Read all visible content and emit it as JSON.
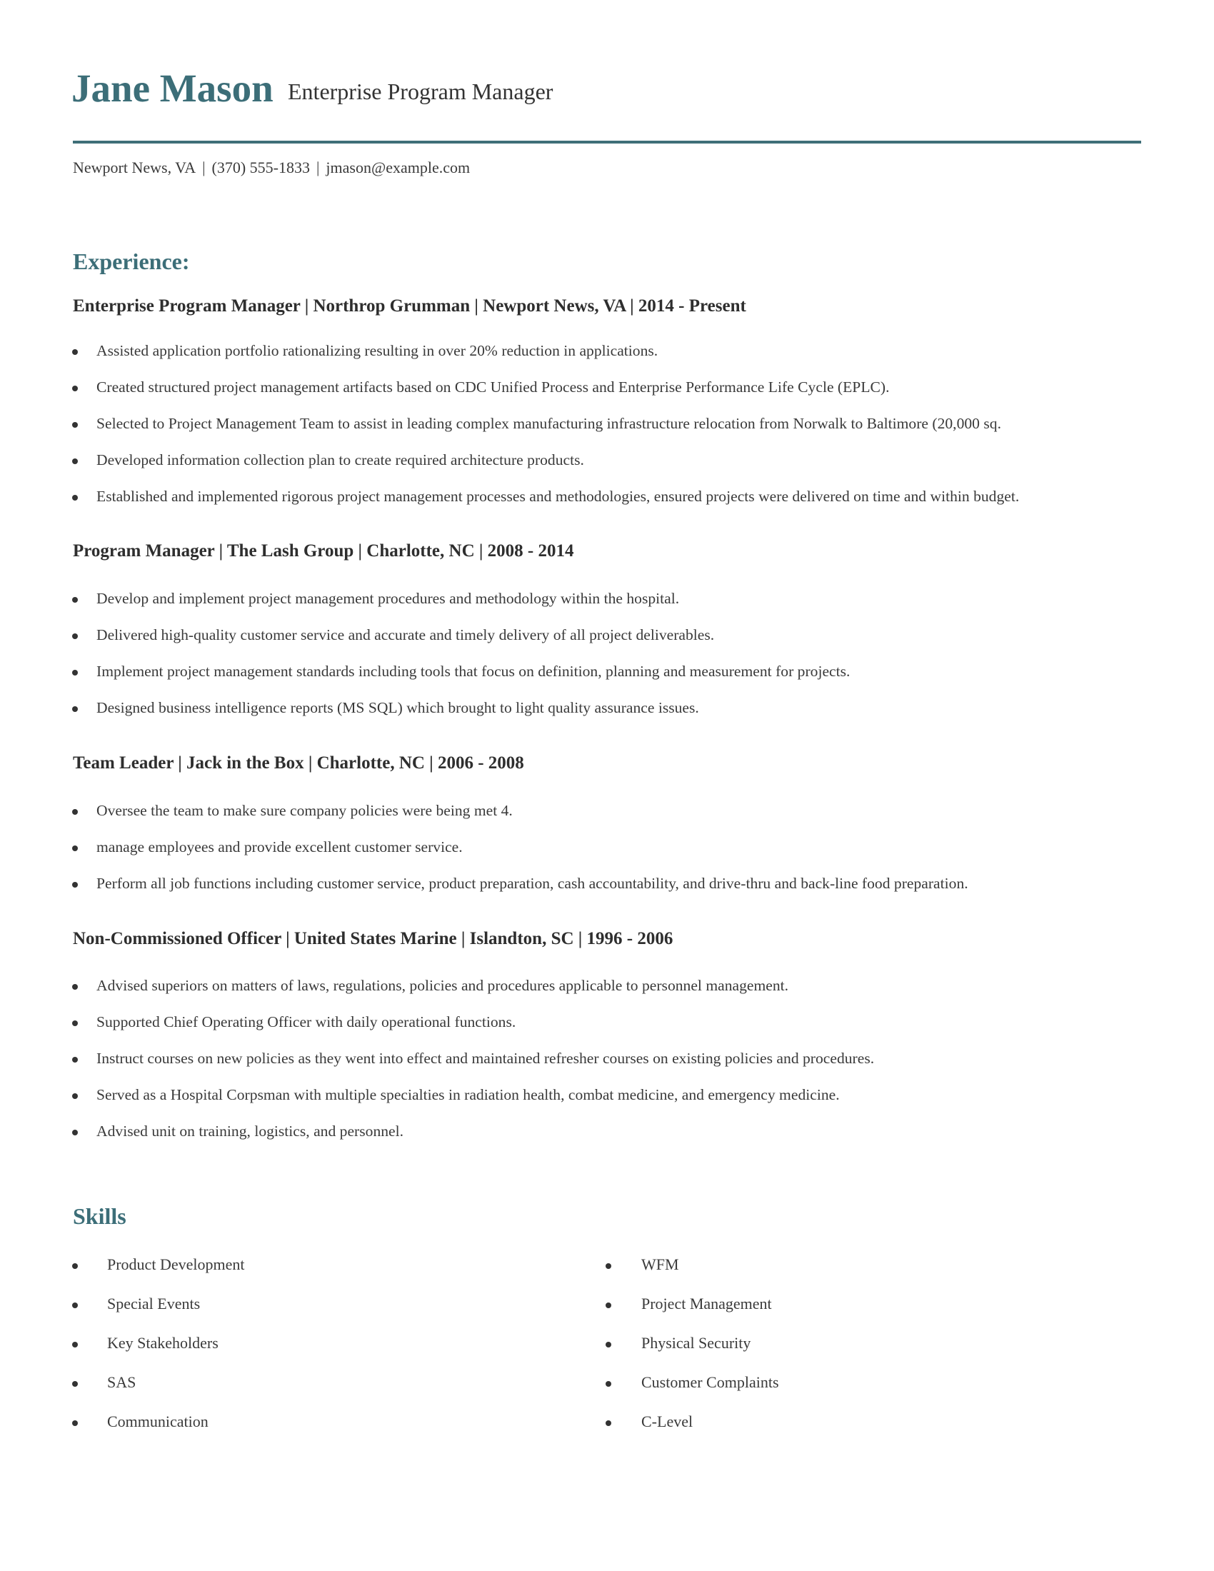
{
  "header": {
    "name": "Jane Mason",
    "title": "Enterprise Program Manager",
    "contact": {
      "location": "Newport News, VA",
      "phone": "(370) 555-1833",
      "email": "jmason@example.com",
      "separator": "|"
    }
  },
  "colors": {
    "accent": "#3c6e78",
    "text": "#333333"
  },
  "experience": {
    "heading": "Experience:",
    "jobs": [
      {
        "title": "Enterprise Program Manager | Northrop Grumman | Newport News, VA |  2014 - Present",
        "bullets": [
          "Assisted application portfolio rationalizing resulting in over 20% reduction in applications.",
          "Created structured project management artifacts based on CDC Unified Process and Enterprise Performance Life Cycle (EPLC).",
          "Selected to Project Management Team to assist in leading complex manufacturing infrastructure relocation from Norwalk to Baltimore (20,000 sq.",
          "Developed information collection plan to create required architecture products.",
          "Established and implemented rigorous project management processes and methodologies, ensured projects were delivered on time and within budget."
        ]
      },
      {
        "title": "Program Manager | The Lash Group | Charlotte, NC |  2008 - 2014",
        "bullets": [
          "Develop and implement project management procedures and methodology within the hospital.",
          "Delivered high-quality customer service and accurate and timely delivery of all project deliverables.",
          "Implement project management standards including tools that focus on definition, planning and measurement for projects.",
          "Designed business intelligence reports (MS SQL) which brought to light quality assurance issues."
        ]
      },
      {
        "title": "Team Leader | Jack in the Box | Charlotte, NC |  2006 - 2008",
        "bullets": [
          "Oversee the team to make sure company policies were being met 4.",
          "manage employees and provide excellent customer service.",
          "Perform all job functions including customer service, product preparation, cash accountability, and drive-thru and back-line food preparation."
        ]
      },
      {
        "title": "Non-Commissioned Officer | United States Marine | Islandton, SC |  1996 - 2006",
        "bullets": [
          "Advised superiors on matters of laws, regulations, policies and procedures applicable to personnel management.",
          "Supported Chief Operating Officer with daily operational functions.",
          "Instruct courses on new policies as they went into effect and maintained refresher courses on existing policies and procedures.",
          "Served as a Hospital Corpsman with multiple specialties in radiation health, combat medicine, and emergency medicine.",
          "Advised unit on training, logistics, and personnel."
        ]
      }
    ]
  },
  "skills": {
    "heading": "Skills",
    "left": [
      "Product Development",
      "Special Events",
      "Key Stakeholders",
      "SAS",
      "Communication"
    ],
    "right": [
      "WFM",
      "Project Management",
      "Physical Security",
      "Customer Complaints",
      "C-Level"
    ]
  }
}
